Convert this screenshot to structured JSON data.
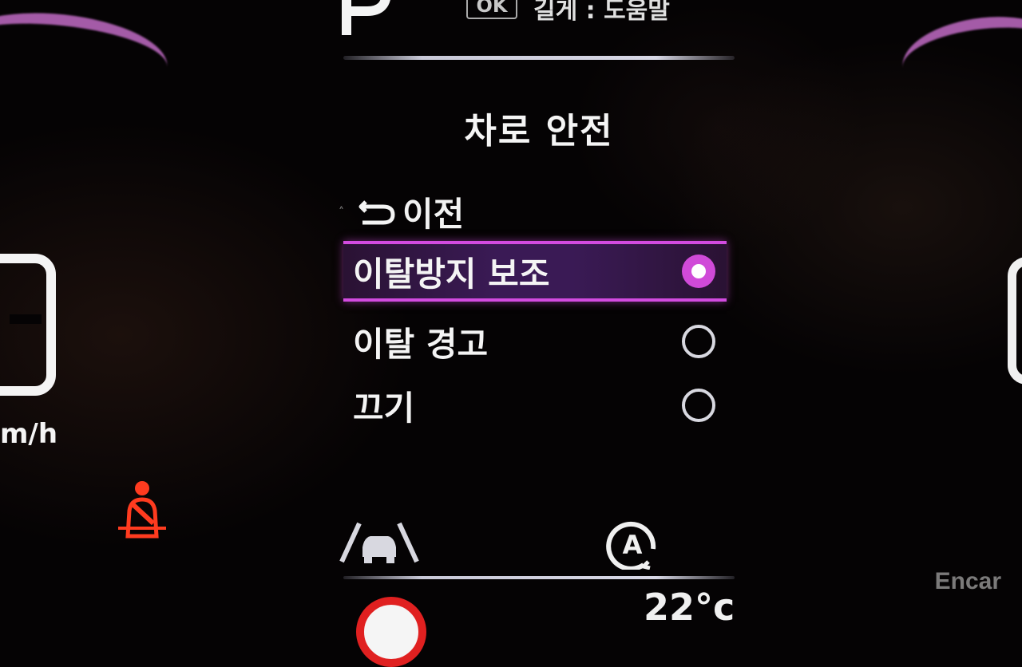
{
  "top_bar": {
    "gear": "P",
    "ok_badge": "OK",
    "ok_hint": "길게 : 도움말"
  },
  "menu": {
    "title": "차로 안전",
    "back_label": "이전",
    "options": [
      {
        "label": "이탈방지 보조",
        "selected": true
      },
      {
        "label": "이탈 경고",
        "selected": false
      },
      {
        "label": "끄기",
        "selected": false
      }
    ]
  },
  "speedometer": {
    "unit": "m/h"
  },
  "status": {
    "temperature": "22°c"
  },
  "icons": {
    "seatbelt": "seatbelt-warning-icon",
    "lane": "lane-assist-icon",
    "auto_hold": "auto-hold-icon"
  },
  "colors": {
    "accent": "#d24be0",
    "warning": "#ff3b1f"
  },
  "watermark": "Encar"
}
